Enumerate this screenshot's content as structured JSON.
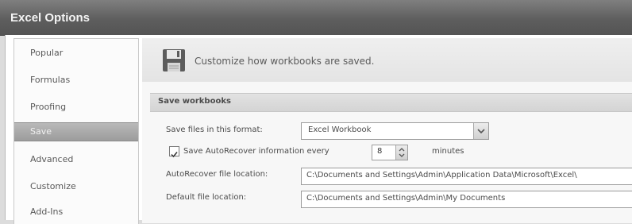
{
  "window": {
    "title": "Excel Options"
  },
  "sidebar": {
    "items": [
      {
        "label": "Popular"
      },
      {
        "label": "Formulas"
      },
      {
        "label": "Proofing"
      },
      {
        "label": "Save",
        "selected": true
      },
      {
        "label": "Advanced"
      },
      {
        "label": "Customize"
      },
      {
        "label": "Add-Ins"
      }
    ]
  },
  "header": {
    "text": "Customize how workbooks are saved.",
    "icon": "floppy-disk-icon"
  },
  "save_section": {
    "title": "Save workbooks",
    "format_label": "Save files in this format:",
    "format_value": "Excel Workbook",
    "autorecover_checked": true,
    "autorecover_label": "Save AutoRecover information every",
    "autorecover_minutes": "8",
    "minutes_label": "minutes",
    "autorecover_location_label": "AutoRecover file location:",
    "autorecover_location_value": "C:\\Documents and Settings\\Admin\\Application Data\\Microsoft\\Excel\\",
    "default_location_label": "Default file location:",
    "default_location_value": "C:\\Documents and Settings\\Admin\\My Documents"
  },
  "colors": {
    "titlebar": "#5e5e5e",
    "selected_item": "#a5a5a5",
    "section_band": "#d9d9d9"
  }
}
